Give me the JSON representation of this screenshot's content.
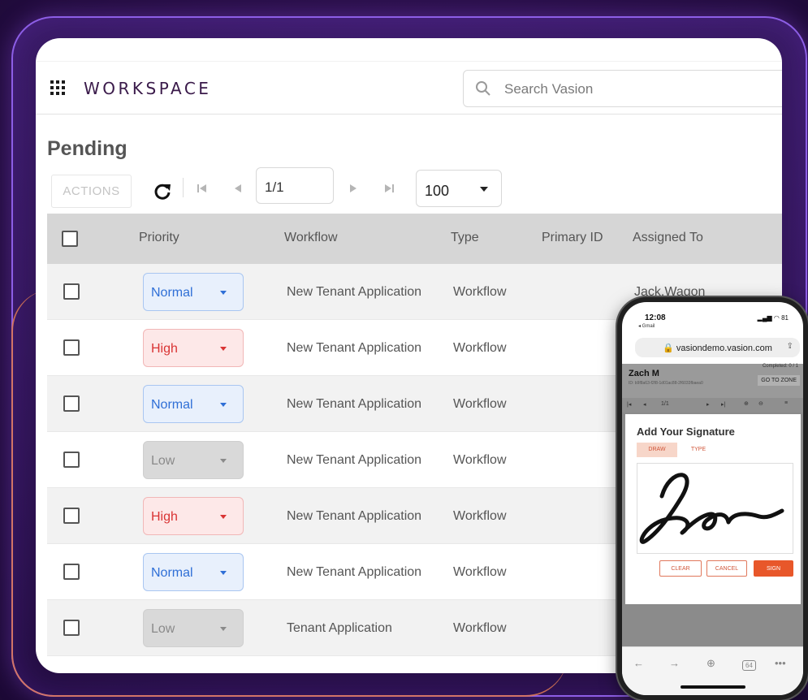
{
  "app": {
    "brand": "WORKSPACE",
    "search": {
      "placeholder": "Search Vasion",
      "value": ""
    }
  },
  "page": {
    "title": "Pending"
  },
  "toolbar": {
    "actions_label": "ACTIONS",
    "page_value": "1/1",
    "per_page": "100"
  },
  "table": {
    "headers": {
      "priority": "Priority",
      "workflow": "Workflow",
      "type": "Type",
      "primary_id": "Primary ID",
      "assigned_to": "Assigned To"
    },
    "rows": [
      {
        "priority": "Normal",
        "workflow": "New Tenant Application",
        "type": "Workflow",
        "primary_id": "",
        "assigned_to": "Jack.Wagon"
      },
      {
        "priority": "High",
        "workflow": "New Tenant Application",
        "type": "Workflow",
        "primary_id": "",
        "assigned_to": ""
      },
      {
        "priority": "Normal",
        "workflow": "New Tenant Application",
        "type": "Workflow",
        "primary_id": "",
        "assigned_to": ""
      },
      {
        "priority": "Low",
        "workflow": "New Tenant Application",
        "type": "Workflow",
        "primary_id": "",
        "assigned_to": ""
      },
      {
        "priority": "High",
        "workflow": "New Tenant Application",
        "type": "Workflow",
        "primary_id": "",
        "assigned_to": ""
      },
      {
        "priority": "Normal",
        "workflow": "New Tenant Application",
        "type": "Workflow",
        "primary_id": "",
        "assigned_to": ""
      },
      {
        "priority": "Low",
        "workflow": "Tenant Application",
        "type": "Workflow",
        "primary_id": "",
        "assigned_to": ""
      }
    ]
  },
  "priority_colors": {
    "Normal": {
      "bg": "#e8f0fc",
      "border": "#a9c6f1",
      "text": "#2f6fd6"
    },
    "High": {
      "bg": "#fde8e8",
      "border": "#f1b7b7",
      "text": "#d93434"
    },
    "Low": {
      "bg": "#d9d9d9",
      "border": "#cfcfcf",
      "text": "#8a8a8a"
    }
  },
  "phone": {
    "time": "12:08",
    "back_app": "◂ Gmail",
    "battery": "81",
    "url": "vasiondemo.vasion.com",
    "signer": "Zach M",
    "id_line": "ID: b9f8a63-f2f8-1d01ac88-2f6033fbaea0",
    "completed": "Completed: 0 / 1",
    "goto_zone": "GO TO ZONE",
    "page_value": "1/1",
    "modal_title": "Add Your Signature",
    "tab_draw": "DRAW",
    "tab_type": "TYPE",
    "btn_clear": "CLEAR",
    "btn_cancel": "CANCEL",
    "btn_sign": "SIGN",
    "tab_count": "64"
  }
}
